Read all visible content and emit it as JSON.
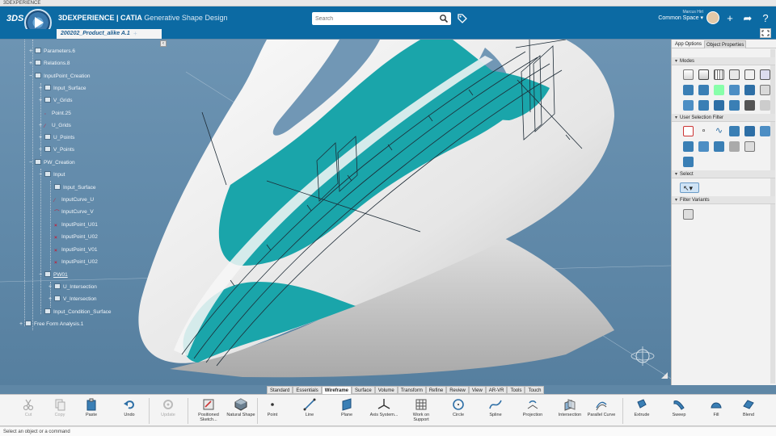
{
  "window": {
    "title": "3DEXPERIENCE"
  },
  "header": {
    "logo": "3DS",
    "brand": "3DEXPERIENCE | CATIA",
    "app_name": "Generative Shape Design",
    "search_placeholder": "Search",
    "user_name": "Marcus Hirt",
    "space": "Common Space"
  },
  "tabs": [
    {
      "label": "200202_Product_alike A.1"
    }
  ],
  "tree": {
    "items": [
      {
        "label": "Parameters.6",
        "icon": "parameters-icon"
      },
      {
        "label": "Relations.8",
        "icon": "relations-icon"
      },
      {
        "label": "InputPoint_Creation",
        "icon": "geoset-icon"
      },
      {
        "label": "Input_Surface",
        "icon": "surface-icon"
      },
      {
        "label": "V_Grids",
        "icon": "grid-icon"
      },
      {
        "label": "Point.25",
        "icon": "point-icon"
      },
      {
        "label": "U_Grids",
        "icon": "grid-icon"
      },
      {
        "label": "U_Points",
        "icon": "points-icon"
      },
      {
        "label": "V_Points",
        "icon": "points-icon"
      },
      {
        "label": "PW_Creation",
        "icon": "geoset-icon"
      },
      {
        "label": "Input",
        "icon": "geoset-icon"
      },
      {
        "label": "Input_Surface",
        "icon": "surface-icon"
      },
      {
        "label": "InputCurve_U",
        "icon": "curve-icon"
      },
      {
        "label": "InputCurve_V",
        "icon": "curve-icon"
      },
      {
        "label": "InputPoint_U01",
        "icon": "point-icon"
      },
      {
        "label": "InputPoint_U02",
        "icon": "point-icon"
      },
      {
        "label": "InputPoint_V01",
        "icon": "point-icon"
      },
      {
        "label": "InputPoint_U02",
        "icon": "point-icon"
      },
      {
        "label": "PW01",
        "icon": "geoset-icon"
      },
      {
        "label": "U_Intersection",
        "icon": "geoset-icon"
      },
      {
        "label": "V_Intersection",
        "icon": "geoset-icon"
      },
      {
        "label": "Input_Condition_Surface",
        "icon": "surface-icon"
      },
      {
        "label": "Free Form Analysis.1",
        "icon": "analysis-icon"
      }
    ]
  },
  "right_panel": {
    "tabs": [
      "App Options",
      "Object Properties"
    ],
    "sections": [
      {
        "title": "Modes"
      },
      {
        "title": "User Selection Filter"
      },
      {
        "title": "Select"
      },
      {
        "title": "Filter Variants"
      }
    ]
  },
  "action_bar": {
    "tabs": [
      "Standard",
      "Essentials",
      "Wireframe",
      "Surface",
      "Volume",
      "Transform",
      "Refine",
      "Review",
      "View",
      "AR-VR",
      "Tools",
      "Touch"
    ],
    "active_tab": "Wireframe",
    "commands": [
      {
        "label": "Cut",
        "icon": "cut-icon",
        "enabled": false
      },
      {
        "label": "Copy",
        "icon": "copy-icon",
        "enabled": false
      },
      {
        "label": "Paste",
        "icon": "paste-icon",
        "enabled": true
      },
      {
        "label": "Undo",
        "icon": "undo-icon",
        "enabled": true
      },
      {
        "label": "Update",
        "icon": "update-icon",
        "enabled": false
      },
      {
        "label": "Positioned Sketch...",
        "icon": "sketch-icon",
        "enabled": true
      },
      {
        "label": "Natural Shape",
        "icon": "natural-shape-icon",
        "enabled": true
      },
      {
        "label": "Point",
        "icon": "point-icon",
        "enabled": true
      },
      {
        "label": "Line",
        "icon": "line-icon",
        "enabled": true
      },
      {
        "label": "Plane",
        "icon": "plane-icon",
        "enabled": true
      },
      {
        "label": "Axis System...",
        "icon": "axis-system-icon",
        "enabled": true
      },
      {
        "label": "Work on Support",
        "icon": "work-on-support-icon",
        "enabled": true
      },
      {
        "label": "Circle",
        "icon": "circle-icon",
        "enabled": true
      },
      {
        "label": "Spline",
        "icon": "spline-icon",
        "enabled": true
      },
      {
        "label": "Projection",
        "icon": "projection-icon",
        "enabled": true
      },
      {
        "label": "Intersection",
        "icon": "intersection-icon",
        "enabled": true
      },
      {
        "label": "Parallel Curve",
        "icon": "parallel-curve-icon",
        "enabled": true
      },
      {
        "label": "Extrude",
        "icon": "extrude-icon",
        "enabled": true
      },
      {
        "label": "Sweep",
        "icon": "sweep-icon",
        "enabled": true
      },
      {
        "label": "Fill",
        "icon": "fill-icon",
        "enabled": true
      },
      {
        "label": "Blend",
        "icon": "blend-icon",
        "enabled": true
      }
    ]
  },
  "status": {
    "text": "Select an object or a command"
  },
  "colors": {
    "brand_blue": "#0c6aa3",
    "viewport_bg": "#5f87a6",
    "teal": "#1aa5aa",
    "part_white": "#eeeeee"
  }
}
